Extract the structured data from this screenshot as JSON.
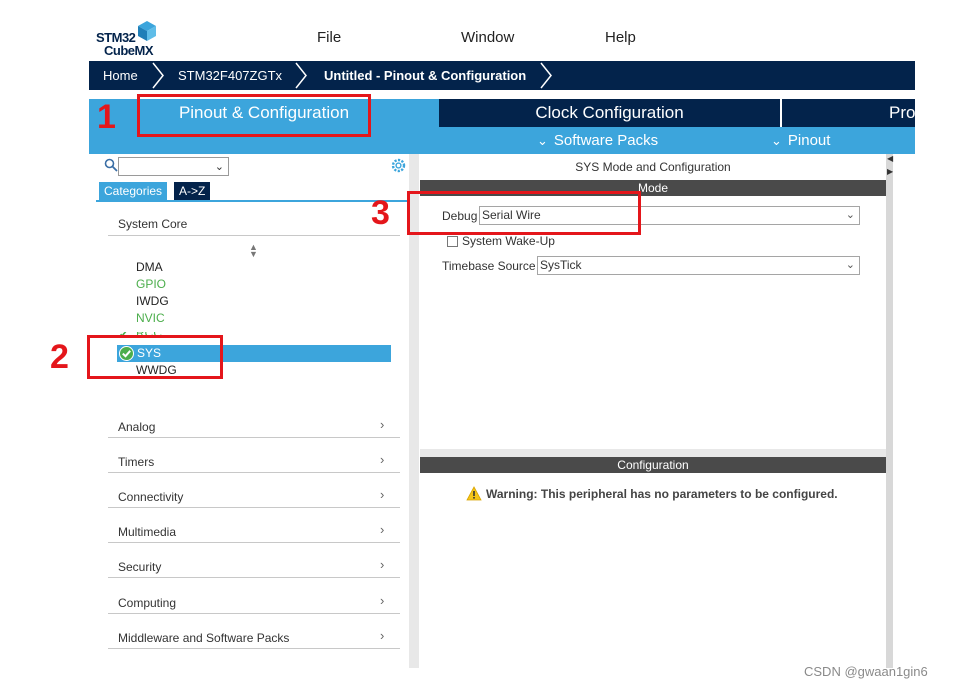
{
  "app": {
    "logo_line1": "STM32",
    "logo_line2": "CubeMX"
  },
  "menu": {
    "file": "File",
    "window": "Window",
    "help": "Help"
  },
  "breadcrumb": {
    "home": "Home",
    "device": "STM32F407ZGTx",
    "project": "Untitled - Pinout & Configuration"
  },
  "tabs": {
    "pinout": "Pinout & Configuration",
    "clock": "Clock Configuration",
    "project": "Pro"
  },
  "subbar": {
    "software_packs": "Software Packs",
    "pinout": "Pinout"
  },
  "left": {
    "categories_tab": "Categories",
    "az_tab": "A->Z",
    "system_core": "System Core",
    "peripherals": [
      {
        "label": "DMA",
        "color": "black"
      },
      {
        "label": "GPIO",
        "color": "green"
      },
      {
        "label": "IWDG",
        "color": "black"
      },
      {
        "label": "NVIC",
        "color": "green"
      },
      {
        "label": "RCC",
        "color": "green"
      },
      {
        "label": "SYS",
        "color": "selected"
      },
      {
        "label": "WWDG",
        "color": "black"
      }
    ],
    "sections": [
      "Analog",
      "Timers",
      "Connectivity",
      "Multimedia",
      "Security",
      "Computing",
      "Middleware and Software Packs"
    ]
  },
  "right": {
    "title": "SYS Mode and Configuration",
    "mode_bar": "Mode",
    "debug_label": "Debug",
    "debug_value": "Serial Wire",
    "wakeup_label": "System Wake-Up",
    "wakeup_checked": false,
    "timebase_label": "Timebase Source",
    "timebase_value": "SysTick",
    "config_bar": "Configuration",
    "warning": "Warning: This peripheral has no parameters to be configured."
  },
  "annotations": {
    "n1": "1",
    "n2": "2",
    "n3": "3",
    "color": "#e4161b"
  },
  "watermark": "CSDN @gwaan1gin6",
  "colors": {
    "navy": "#03234b",
    "accent": "#3ca5dc",
    "green": "#4cae4c"
  }
}
